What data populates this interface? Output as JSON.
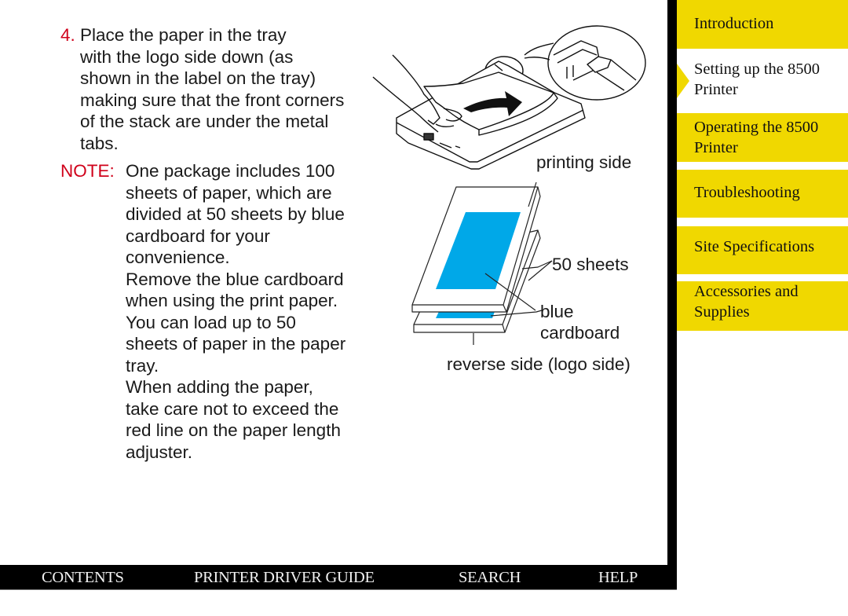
{
  "step": {
    "number": "4.",
    "lines": [
      "Place the paper in the tray",
      "with the logo side down (as",
      "shown in the label on the tray)",
      "making sure that the front corners",
      "of the stack are under the metal",
      "tabs."
    ]
  },
  "note": {
    "label": "NOTE:",
    "lines": [
      "One package includes 100",
      "sheets of paper, which are",
      "divided at 50 sheets by blue",
      "cardboard for your",
      "convenience.",
      "Remove the blue cardboard",
      "when using the print paper.",
      "You can load up to 50",
      "sheets of paper in the paper",
      "tray.",
      "When adding the paper,",
      "take care not to exceed the",
      "red line on the paper length",
      "adjuster."
    ]
  },
  "figure": {
    "printing_side": "printing side",
    "fifty_sheets": "50 sheets",
    "blue": "blue",
    "cardboard": "cardboard",
    "reverse_side": "reverse side (logo side)",
    "colors": {
      "blue_fill": "#00a8e8"
    }
  },
  "sidebar": {
    "items": [
      {
        "label_lines": [
          "Introduction"
        ],
        "state": "normal"
      },
      {
        "label_lines": [
          "Setting up the 8500",
          "Printer"
        ],
        "state": "active"
      },
      {
        "label_lines": [
          "Operating the 8500",
          "Printer"
        ],
        "state": "normal"
      },
      {
        "label_lines": [
          "Troubleshooting"
        ],
        "state": "normal"
      },
      {
        "label_lines": [
          "Site Specifications"
        ],
        "state": "normal"
      },
      {
        "label_lines": [
          "Accessories and",
          "Supplies"
        ],
        "state": "normal"
      }
    ],
    "colors": {
      "tab": "#f0d800"
    }
  },
  "navbar": {
    "contents": "CONTENTS",
    "printer_driver_guide": "PRINTER DRIVER GUIDE",
    "search": "SEARCH",
    "help": "HELP"
  }
}
